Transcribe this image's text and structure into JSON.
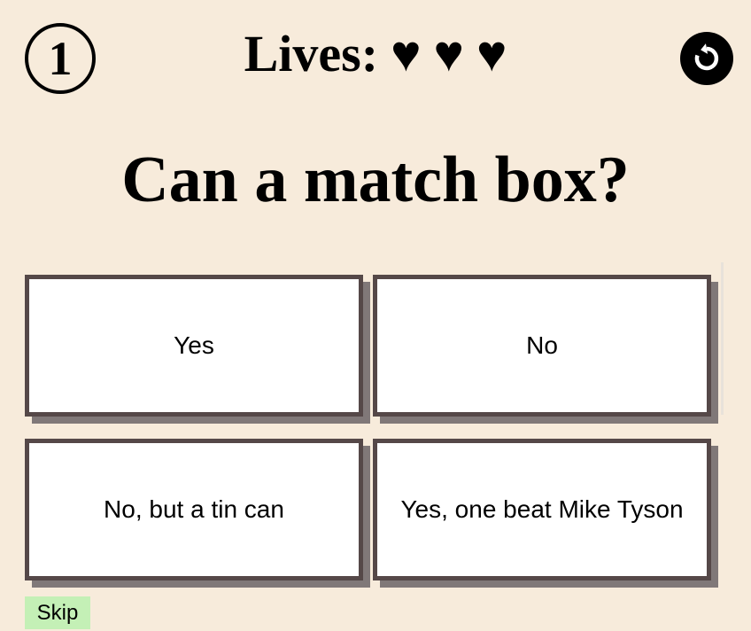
{
  "level": "1",
  "lives": {
    "label": "Lives:",
    "hearts": [
      "♥",
      "♥",
      "♥"
    ],
    "count": 3
  },
  "restart_icon": "restart-icon",
  "question": "Can a match box?",
  "answers": [
    "Yes",
    "No",
    "No, but a tin can",
    "Yes, one beat Mike Tyson"
  ],
  "skip_label": "Skip",
  "colors": {
    "background": "#f7ebdb",
    "card_border": "#554848",
    "card_shadow": "#807878",
    "skip_bg": "#c4f0b6"
  }
}
